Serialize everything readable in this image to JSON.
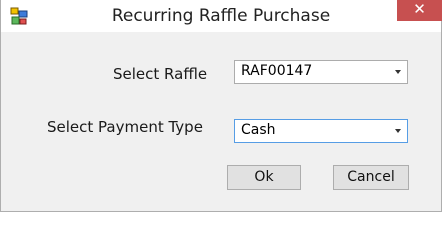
{
  "window": {
    "title": "Recurring Raffle Purchase",
    "close_glyph": "✕"
  },
  "form": {
    "raffle_label": "Select Raffle",
    "raffle_value": "RAF00147",
    "payment_label": "Select Payment Type",
    "payment_value": "Cash"
  },
  "buttons": {
    "ok_label": "Ok",
    "cancel_label": "Cancel"
  },
  "icons": {
    "app": "app-icon",
    "close": "close-icon",
    "dropdown": "chevron-down-icon"
  },
  "colors": {
    "close_button": "#c75050",
    "focus_border": "#569de5"
  }
}
